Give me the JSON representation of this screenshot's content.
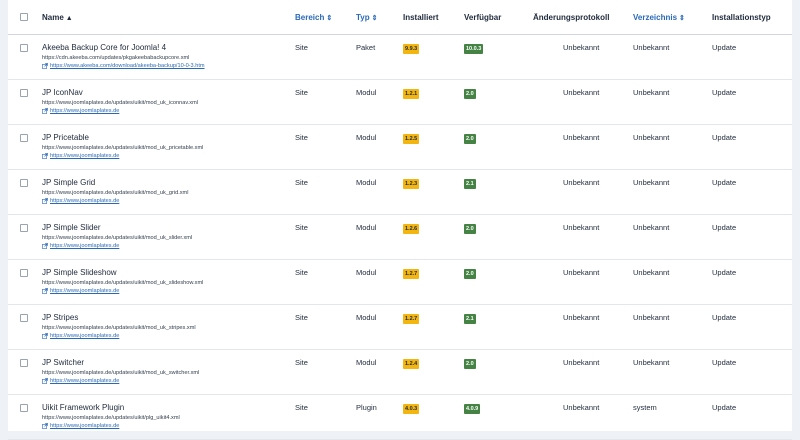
{
  "columns": {
    "checkbox": "",
    "name": "Name",
    "bereich": "Bereich",
    "typ": "Typ",
    "installiert": "Installiert",
    "verfuegbar": "Verfügbar",
    "changelog": "Änderungsprotokoll",
    "verzeichnis": "Verzeichnis",
    "installationstyp": "Installationstyp"
  },
  "sort_arrow_up": "▲",
  "sort_arrow_both": "⇕",
  "colors": {
    "installed_badge": "#f3b50f",
    "available_badge": "#448344",
    "link": "#2a69b8"
  },
  "rows": [
    {
      "name": "Akeeba Backup Core for Joomla! 4",
      "url": "https://cdn.akeeba.com/updates/pkgakeebabackupcore.xml",
      "link": "https://www.akeeba.com/download/akeeba-backup/10-0-3.htm",
      "bereich": "Site",
      "typ": "Paket",
      "installiert": "9.9.3",
      "verfuegbar": "10.0.3",
      "changelog": "Unbekannt",
      "verzeichnis": "Unbekannt",
      "installationstyp": "Update"
    },
    {
      "name": "JP IconNav",
      "url": "https://www.joomlaplates.de/updates/uikit/mod_uk_iconnav.xml",
      "link": "https://www.joomlaplates.de",
      "bereich": "Site",
      "typ": "Modul",
      "installiert": "1.2.1",
      "verfuegbar": "2.0",
      "changelog": "Unbekannt",
      "verzeichnis": "Unbekannt",
      "installationstyp": "Update"
    },
    {
      "name": "JP Pricetable",
      "url": "https://www.joomlaplates.de/updates/uikit/mod_uk_pricetable.xml",
      "link": "https://www.joomlaplates.de",
      "bereich": "Site",
      "typ": "Modul",
      "installiert": "1.2.5",
      "verfuegbar": "2.0",
      "changelog": "Unbekannt",
      "verzeichnis": "Unbekannt",
      "installationstyp": "Update"
    },
    {
      "name": "JP Simple Grid",
      "url": "https://www.joomlaplates.de/updates/uikit/mod_uk_grid.xml",
      "link": "https://www.joomlaplates.de",
      "bereich": "Site",
      "typ": "Modul",
      "installiert": "1.2.3",
      "verfuegbar": "2.1",
      "changelog": "Unbekannt",
      "verzeichnis": "Unbekannt",
      "installationstyp": "Update"
    },
    {
      "name": "JP Simple Slider",
      "url": "https://www.joomlaplates.de/updates/uikit/mod_uk_slider.xml",
      "link": "https://www.joomlaplates.de",
      "bereich": "Site",
      "typ": "Modul",
      "installiert": "1.2.6",
      "verfuegbar": "2.0",
      "changelog": "Unbekannt",
      "verzeichnis": "Unbekannt",
      "installationstyp": "Update"
    },
    {
      "name": "JP Simple Slideshow",
      "url": "https://www.joomlaplates.de/updates/uikit/mod_uk_slideshow.xml",
      "link": "https://www.joomlaplates.de",
      "bereich": "Site",
      "typ": "Modul",
      "installiert": "1.2.7",
      "verfuegbar": "2.0",
      "changelog": "Unbekannt",
      "verzeichnis": "Unbekannt",
      "installationstyp": "Update"
    },
    {
      "name": "JP Stripes",
      "url": "https://www.joomlaplates.de/updates/uikit/mod_uk_stripes.xml",
      "link": "https://www.joomlaplates.de",
      "bereich": "Site",
      "typ": "Modul",
      "installiert": "1.2.7",
      "verfuegbar": "2.1",
      "changelog": "Unbekannt",
      "verzeichnis": "Unbekannt",
      "installationstyp": "Update"
    },
    {
      "name": "JP Switcher",
      "url": "https://www.joomlaplates.de/updates/uikit/mod_uk_switcher.xml",
      "link": "https://www.joomlaplates.de",
      "bereich": "Site",
      "typ": "Modul",
      "installiert": "1.2.4",
      "verfuegbar": "2.0",
      "changelog": "Unbekannt",
      "verzeichnis": "Unbekannt",
      "installationstyp": "Update"
    },
    {
      "name": "Uikit Framework Plugin",
      "url": "https://www.joomlaplates.de/updates/uikit/plg_uikit4.xml",
      "link": "https://www.joomlaplates.de",
      "bereich": "Site",
      "typ": "Plugin",
      "installiert": "4.0.3",
      "verfuegbar": "4.0.9",
      "changelog": "Unbekannt",
      "verzeichnis": "system",
      "installationstyp": "Update"
    }
  ]
}
